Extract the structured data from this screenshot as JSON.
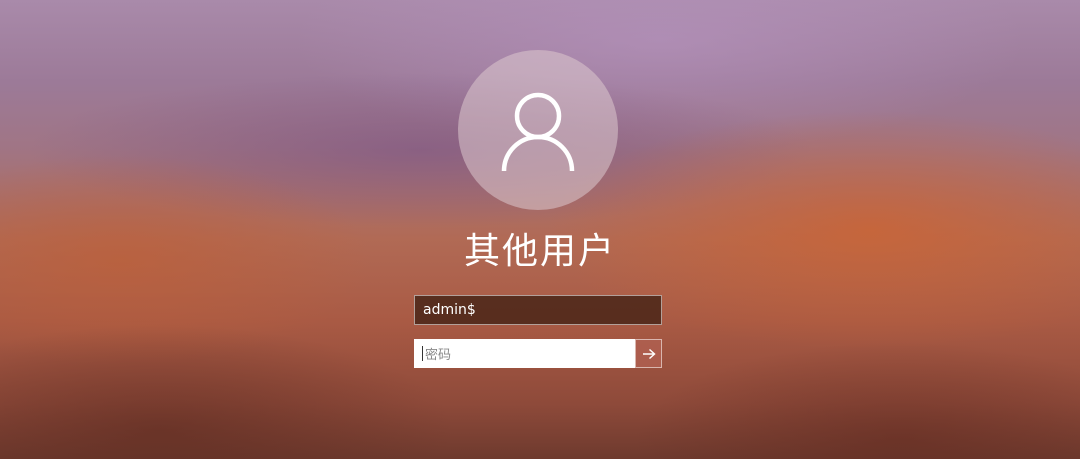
{
  "user": {
    "display_name": "其他用户",
    "avatar_icon": "user-silhouette-icon"
  },
  "login": {
    "username_value": "admin$",
    "password_placeholder": "密码",
    "submit_icon": "arrow-right-icon"
  },
  "colors": {
    "username_field_bg": "#46231a",
    "password_field_bg": "#ffffff",
    "text_white": "#ffffff"
  }
}
